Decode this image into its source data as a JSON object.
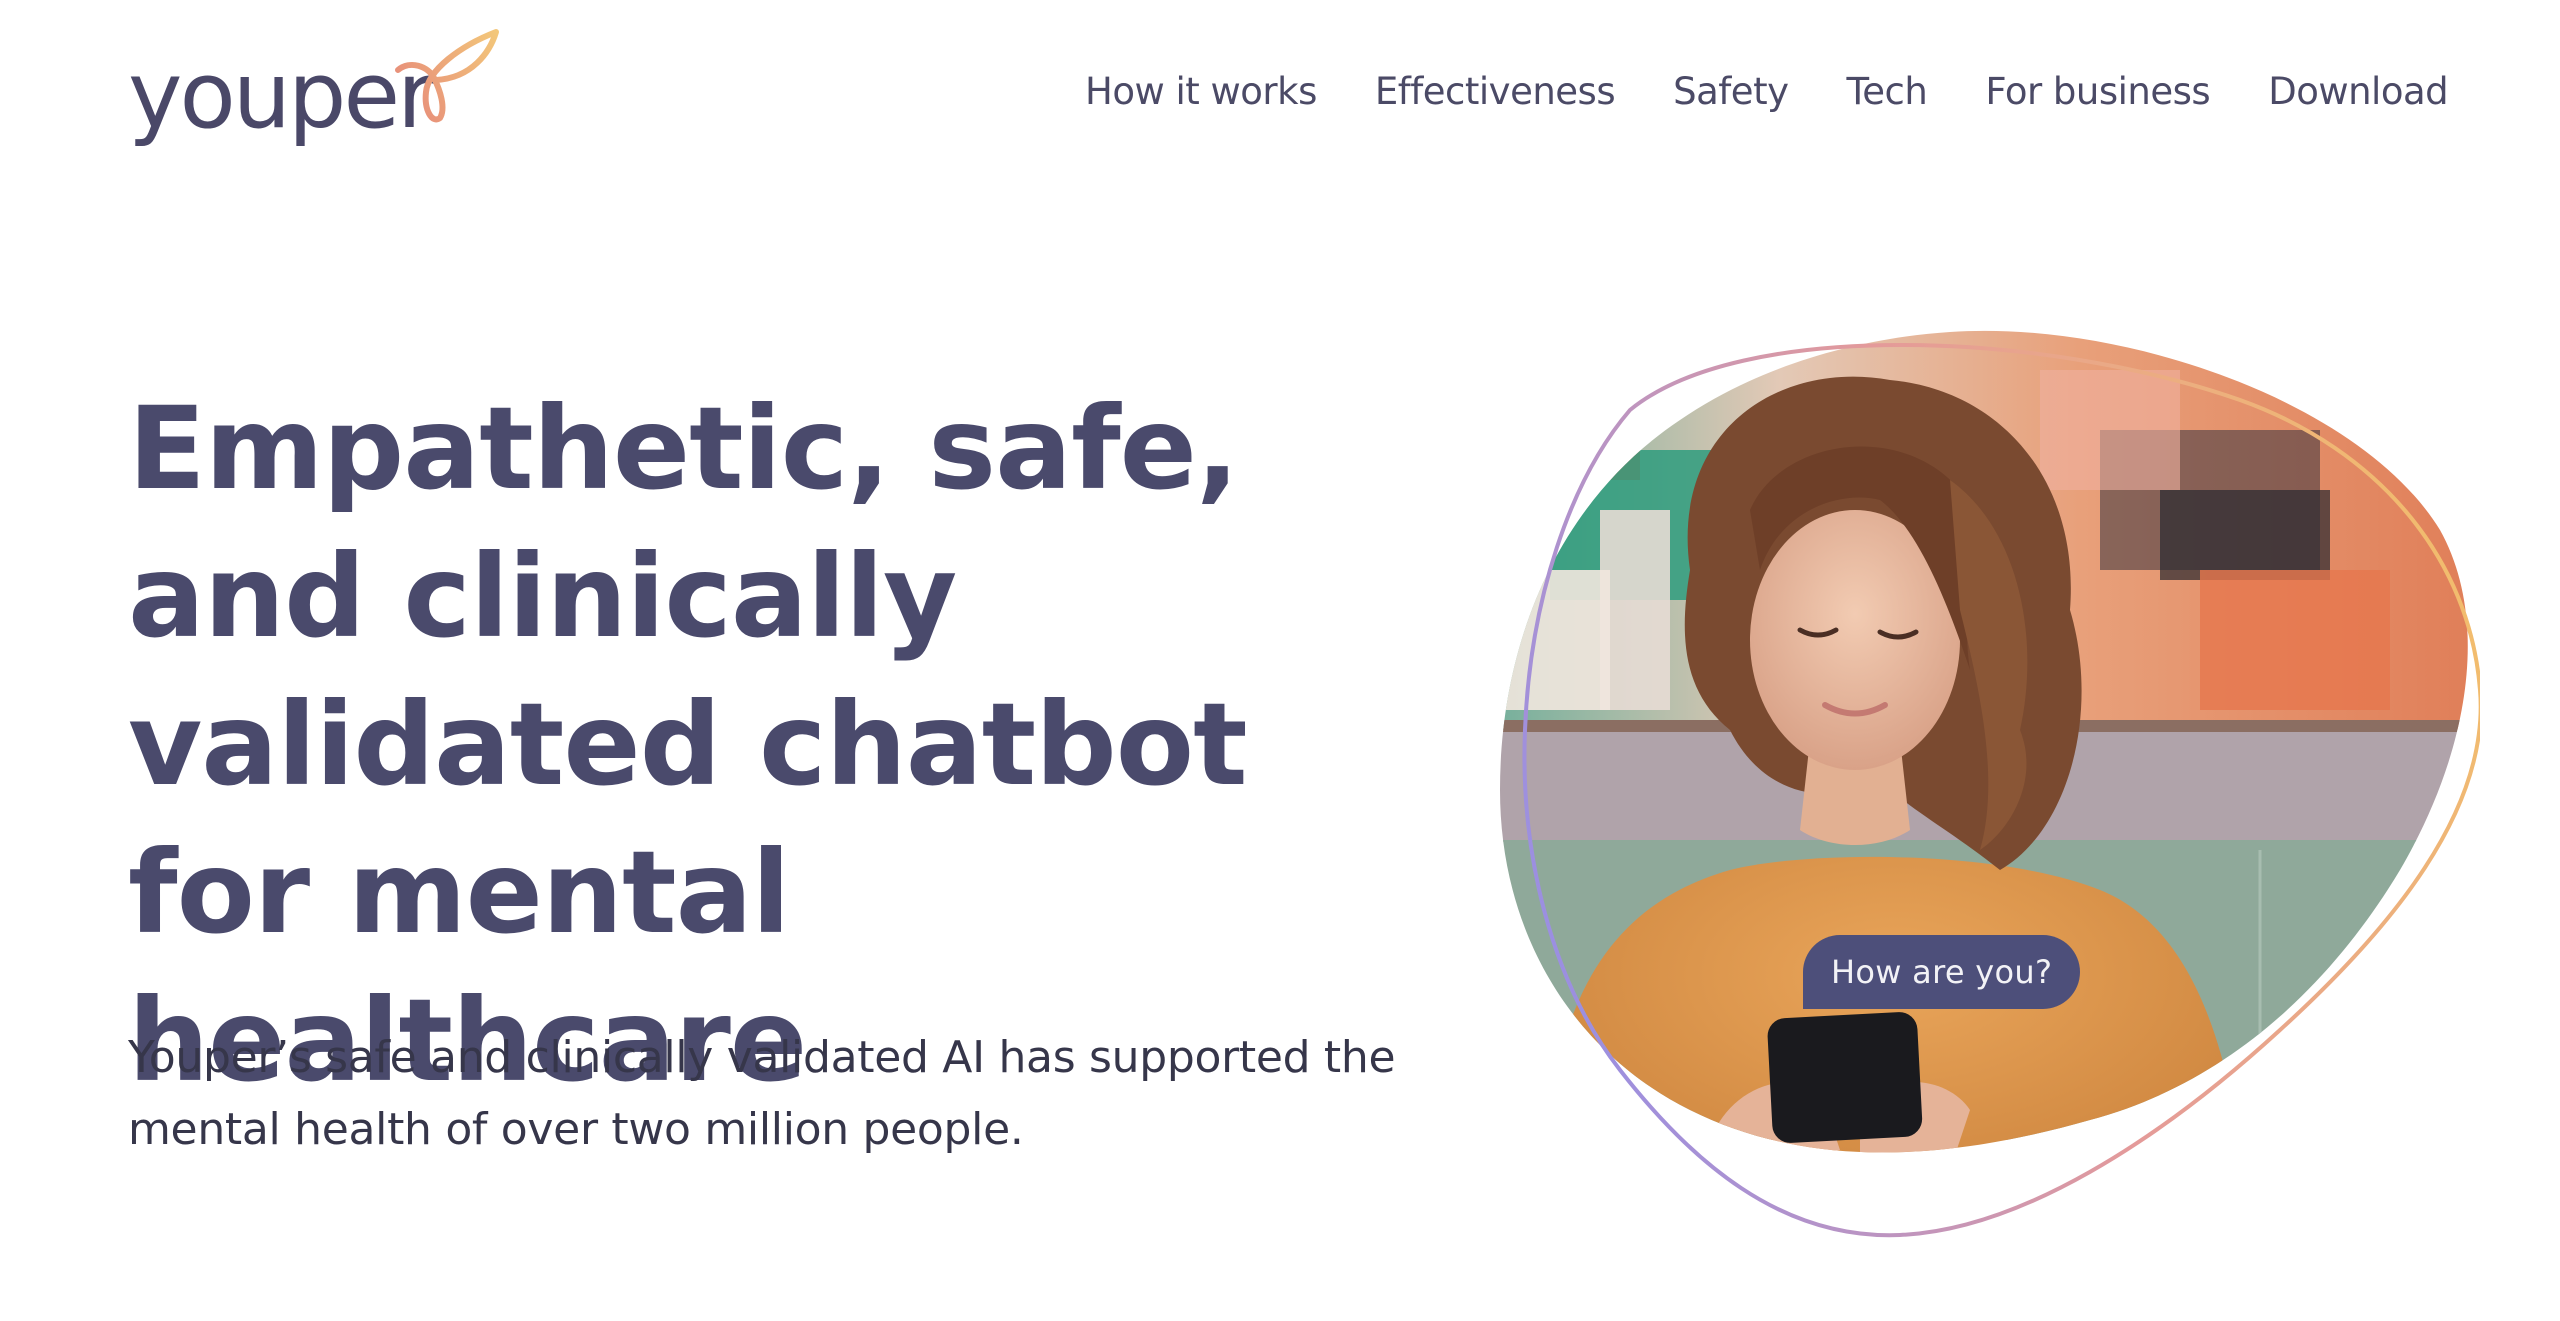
{
  "brand": {
    "name": "youper",
    "logo_icon": "leaf-bird-icon",
    "colors": {
      "primary": "#4a4a6c",
      "logo_gradient_start": "#e8917a",
      "logo_gradient_end": "#f3c77a",
      "outline_gradient_start": "#9b8fe0",
      "outline_gradient_end": "#f2b86a",
      "bubble": "#4d4f7a"
    }
  },
  "nav": {
    "items": [
      {
        "label": "How it works"
      },
      {
        "label": "Effectiveness"
      },
      {
        "label": "Safety"
      },
      {
        "label": "Tech"
      },
      {
        "label": "For business"
      },
      {
        "label": "Download"
      }
    ]
  },
  "hero": {
    "title": "Empathetic, safe, and clinically validated chatbot for mental healthcare",
    "subtitle": "Youper’s safe and clinically validated AI has supported the mental health of over two million people.",
    "image_alt": "Young woman with curly hair in an orange sweater smiling at her phone",
    "chat_bubble": "How are you?"
  }
}
